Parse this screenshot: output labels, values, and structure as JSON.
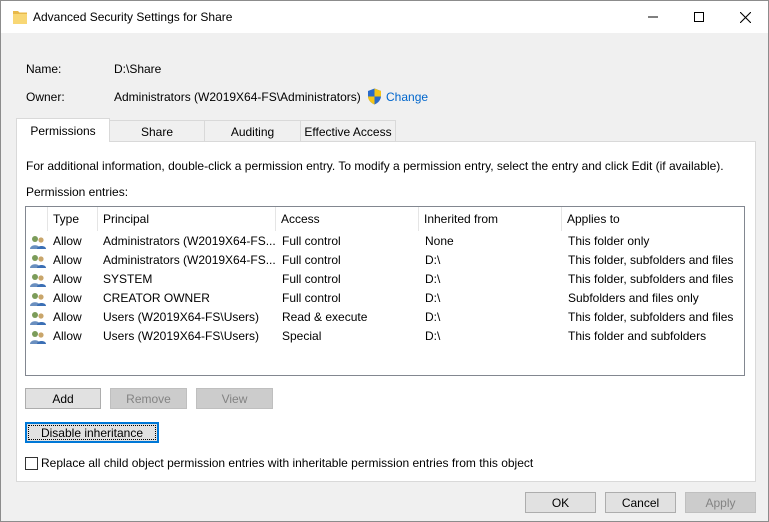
{
  "window": {
    "title": "Advanced Security Settings for Share"
  },
  "info": {
    "name_label": "Name:",
    "name_value": "D:\\Share",
    "owner_label": "Owner:",
    "owner_value": "Administrators (W2019X64-FS\\Administrators)",
    "change_link": "Change"
  },
  "tabs": [
    {
      "label": "Permissions",
      "active": true
    },
    {
      "label": "Share",
      "active": false
    },
    {
      "label": "Auditing",
      "active": false
    },
    {
      "label": "Effective Access",
      "active": false
    }
  ],
  "panel": {
    "description": "For additional information, double-click a permission entry. To modify a permission entry, select the entry and click Edit (if available).",
    "entries_label": "Permission entries:"
  },
  "columns": [
    "Type",
    "Principal",
    "Access",
    "Inherited from",
    "Applies to"
  ],
  "entries": [
    {
      "type": "Allow",
      "principal": "Administrators (W2019X64-FS...",
      "access": "Full control",
      "inherited": "None",
      "applies": "This folder only"
    },
    {
      "type": "Allow",
      "principal": "Administrators (W2019X64-FS...",
      "access": "Full control",
      "inherited": "D:\\",
      "applies": "This folder, subfolders and files"
    },
    {
      "type": "Allow",
      "principal": "SYSTEM",
      "access": "Full control",
      "inherited": "D:\\",
      "applies": "This folder, subfolders and files"
    },
    {
      "type": "Allow",
      "principal": "CREATOR OWNER",
      "access": "Full control",
      "inherited": "D:\\",
      "applies": "Subfolders and files only"
    },
    {
      "type": "Allow",
      "principal": "Users (W2019X64-FS\\Users)",
      "access": "Read & execute",
      "inherited": "D:\\",
      "applies": "This folder, subfolders and files"
    },
    {
      "type": "Allow",
      "principal": "Users (W2019X64-FS\\Users)",
      "access": "Special",
      "inherited": "D:\\",
      "applies": "This folder and subfolders"
    }
  ],
  "buttons": {
    "add": "Add",
    "remove": "Remove",
    "view": "View",
    "disable_inheritance": "Disable inheritance",
    "ok": "OK",
    "cancel": "Cancel",
    "apply": "Apply"
  },
  "replace_checkbox": {
    "label": "Replace all child object permission entries with inheritable permission entries from this object",
    "checked": false
  },
  "icons": {
    "title": "folder-icon",
    "owner_change": "uac-shield-icon",
    "entry": "users-group-icon"
  }
}
